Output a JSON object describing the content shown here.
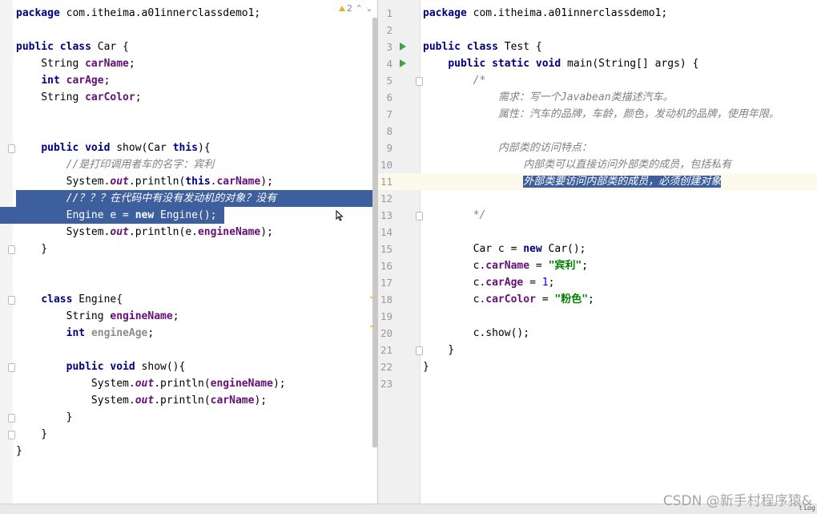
{
  "left": {
    "problems": "2",
    "lines": [
      {
        "t": [
          [
            "kw",
            "package"
          ],
          [
            "",
            " com.itheima.a01innerclassdemo1;"
          ]
        ]
      },
      {
        "t": []
      },
      {
        "t": [
          [
            "kw",
            "public class"
          ],
          [
            "",
            " Car {"
          ]
        ]
      },
      {
        "t": [
          [
            "",
            "    String "
          ],
          [
            "fld",
            "carName"
          ],
          [
            "",
            ";"
          ]
        ]
      },
      {
        "t": [
          [
            "",
            "    "
          ],
          [
            "kw",
            "int"
          ],
          [
            "",
            " "
          ],
          [
            "fld",
            "carAge"
          ],
          [
            "",
            ";"
          ]
        ]
      },
      {
        "t": [
          [
            "",
            "    String "
          ],
          [
            "fld",
            "carColor"
          ],
          [
            "",
            ";"
          ]
        ]
      },
      {
        "t": []
      },
      {
        "t": []
      },
      {
        "t": [
          [
            "",
            "    "
          ],
          [
            "kw",
            "public void"
          ],
          [
            "",
            " show(Car "
          ],
          [
            "kw",
            "this"
          ],
          [
            "",
            "){"
          ]
        ]
      },
      {
        "t": [
          [
            "",
            "        "
          ],
          [
            "cmt",
            "//是打印调用者车的名字：宾利"
          ]
        ]
      },
      {
        "t": [
          [
            "",
            "        System."
          ],
          [
            "ital",
            "out"
          ],
          [
            "",
            ".println("
          ],
          [
            "kw",
            "this"
          ],
          [
            "",
            "."
          ],
          [
            "fld",
            "carName"
          ],
          [
            "",
            ");"
          ]
        ]
      },
      {
        "t": [
          [
            "",
            "        "
          ],
          [
            "cmt",
            "//？？？在代码中有没有发动机的对象？没有"
          ]
        ],
        "sel": true
      },
      {
        "t": [
          [
            "",
            "        Engine e = "
          ],
          [
            "kw",
            "new"
          ],
          [
            "",
            " Engine();"
          ]
        ],
        "sel": true
      },
      {
        "t": [
          [
            "",
            "        System."
          ],
          [
            "ital",
            "out"
          ],
          [
            "",
            ".println(e."
          ],
          [
            "fld",
            "engineName"
          ],
          [
            "",
            ");"
          ]
        ]
      },
      {
        "t": [
          [
            "",
            "    }"
          ]
        ]
      },
      {
        "t": []
      },
      {
        "t": []
      },
      {
        "t": [
          [
            "",
            "    "
          ],
          [
            "kw",
            "class"
          ],
          [
            "",
            " Engine{"
          ]
        ]
      },
      {
        "t": [
          [
            "",
            "        String "
          ],
          [
            "fld",
            "engineName"
          ],
          [
            "",
            ";"
          ]
        ]
      },
      {
        "t": [
          [
            "",
            "        "
          ],
          [
            "kw",
            "int"
          ],
          [
            "",
            " "
          ],
          [
            "fldg",
            "engineAge"
          ],
          [
            "",
            ";"
          ]
        ]
      },
      {
        "t": []
      },
      {
        "t": [
          [
            "",
            "        "
          ],
          [
            "kw",
            "public void"
          ],
          [
            "",
            " show(){"
          ]
        ]
      },
      {
        "t": [
          [
            "",
            "            System."
          ],
          [
            "ital",
            "out"
          ],
          [
            "",
            ".println("
          ],
          [
            "fld",
            "engineName"
          ],
          [
            "",
            ");"
          ]
        ]
      },
      {
        "t": [
          [
            "",
            "            System."
          ],
          [
            "ital",
            "out"
          ],
          [
            "",
            ".println("
          ],
          [
            "fld",
            "carName"
          ],
          [
            "",
            ");"
          ]
        ]
      },
      {
        "t": [
          [
            "",
            "        }"
          ]
        ]
      },
      {
        "t": [
          [
            "",
            "    }"
          ]
        ]
      },
      {
        "t": [
          [
            "",
            "}"
          ]
        ]
      }
    ]
  },
  "right": {
    "lines": [
      {
        "n": "1",
        "t": [
          [
            "kw",
            "package"
          ],
          [
            "",
            " com.itheima.a01innerclassdemo1;"
          ]
        ]
      },
      {
        "n": "2",
        "t": []
      },
      {
        "n": "3",
        "run": true,
        "t": [
          [
            "kw",
            "public class"
          ],
          [
            "",
            " Test {"
          ]
        ]
      },
      {
        "n": "4",
        "run": true,
        "t": [
          [
            "",
            "    "
          ],
          [
            "kw",
            "public static void"
          ],
          [
            "",
            " main(String[] args) {"
          ]
        ]
      },
      {
        "n": "5",
        "t": [
          [
            "",
            "        "
          ],
          [
            "cmt",
            "/*"
          ]
        ]
      },
      {
        "n": "6",
        "t": [
          [
            "",
            "            "
          ],
          [
            "cmt",
            "需求：写一个Javabean类描述汽车。"
          ]
        ]
      },
      {
        "n": "7",
        "t": [
          [
            "",
            "            "
          ],
          [
            "cmt",
            "属性：汽车的品牌，车龄，颜色，发动机的品牌，使用年限。"
          ]
        ]
      },
      {
        "n": "8",
        "t": []
      },
      {
        "n": "9",
        "t": [
          [
            "",
            "            "
          ],
          [
            "cmt",
            "内部类的访问特点："
          ]
        ]
      },
      {
        "n": "10",
        "t": [
          [
            "",
            "                "
          ],
          [
            "cmt",
            "内部类可以直接访问外部类的成员，包括私有"
          ]
        ]
      },
      {
        "n": "11",
        "caret": true,
        "t": [
          [
            "",
            "                "
          ],
          [
            "cmt",
            "外部类要访问内部类的成员，必须创建对象"
          ]
        ]
      },
      {
        "n": "12",
        "t": []
      },
      {
        "n": "13",
        "t": [
          [
            "",
            "        "
          ],
          [
            "cmt",
            "*/"
          ]
        ]
      },
      {
        "n": "14",
        "t": []
      },
      {
        "n": "15",
        "t": [
          [
            "",
            "        Car c = "
          ],
          [
            "kw",
            "new"
          ],
          [
            "",
            " Car();"
          ]
        ]
      },
      {
        "n": "16",
        "t": [
          [
            "",
            "        c."
          ],
          [
            "fld",
            "carName"
          ],
          [
            "",
            " = "
          ],
          [
            "str",
            "\"宾利\""
          ],
          [
            "",
            ";"
          ]
        ]
      },
      {
        "n": "17",
        "t": [
          [
            "",
            "        c."
          ],
          [
            "fld",
            "carAge"
          ],
          [
            "",
            " = "
          ],
          [
            "num",
            "1"
          ],
          [
            "",
            ";"
          ]
        ]
      },
      {
        "n": "18",
        "t": [
          [
            "",
            "        c."
          ],
          [
            "fld",
            "carColor"
          ],
          [
            "",
            " = "
          ],
          [
            "str",
            "\"粉色\""
          ],
          [
            "",
            ";"
          ]
        ]
      },
      {
        "n": "19",
        "t": []
      },
      {
        "n": "20",
        "t": [
          [
            "",
            "        c.show();"
          ]
        ]
      },
      {
        "n": "21",
        "t": [
          [
            "",
            "    }"
          ]
        ]
      },
      {
        "n": "22",
        "t": [
          [
            "",
            "}"
          ]
        ]
      },
      {
        "n": "23",
        "t": []
      }
    ]
  },
  "colors": {
    "keyword": "#000080",
    "field": "#660e7a",
    "string": "#008000",
    "comment": "#808080",
    "selection": "#3d5f9e"
  },
  "watermark": "CSDN @新手村程序猿&",
  "status_right": "t Log"
}
